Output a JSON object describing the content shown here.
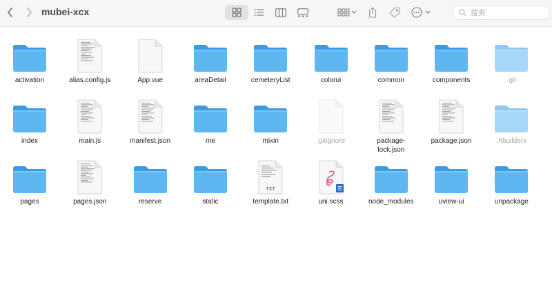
{
  "window": {
    "title": "mubei-xcx"
  },
  "toolbar": {
    "search_placeholder": "搜索"
  },
  "files": [
    {
      "name": "activation",
      "kind": "folder"
    },
    {
      "name": "alias.config.js",
      "kind": "doc-lines"
    },
    {
      "name": "App.vue",
      "kind": "doc-blank"
    },
    {
      "name": "areaDetail",
      "kind": "folder"
    },
    {
      "name": "cemeteryList",
      "kind": "folder"
    },
    {
      "name": "colorui",
      "kind": "folder"
    },
    {
      "name": "common",
      "kind": "folder"
    },
    {
      "name": "components",
      "kind": "folder"
    },
    {
      "name": ".git",
      "kind": "folder",
      "hidden": true
    },
    {
      "name": "index",
      "kind": "folder"
    },
    {
      "name": "main.js",
      "kind": "doc-lines"
    },
    {
      "name": "manifest.json",
      "kind": "doc-lines"
    },
    {
      "name": "me",
      "kind": "folder"
    },
    {
      "name": "mixin",
      "kind": "folder"
    },
    {
      "name": ".gitignore",
      "kind": "doc-blank",
      "hidden": true
    },
    {
      "name": "package-\nlock.json",
      "kind": "doc-lines"
    },
    {
      "name": "package.json",
      "kind": "doc-lines"
    },
    {
      "name": ".hbuilderx",
      "kind": "folder",
      "hidden": true
    },
    {
      "name": "pages",
      "kind": "folder"
    },
    {
      "name": "pages.json",
      "kind": "doc-lines"
    },
    {
      "name": "reserve",
      "kind": "folder"
    },
    {
      "name": "static",
      "kind": "folder"
    },
    {
      "name": "template.txt",
      "kind": "doc-txt",
      "badge": "TXT"
    },
    {
      "name": "uni.scss",
      "kind": "doc-scss"
    },
    {
      "name": "node_modules",
      "kind": "folder"
    },
    {
      "name": "uview-ui",
      "kind": "folder"
    },
    {
      "name": "unpackage",
      "kind": "folder"
    }
  ]
}
